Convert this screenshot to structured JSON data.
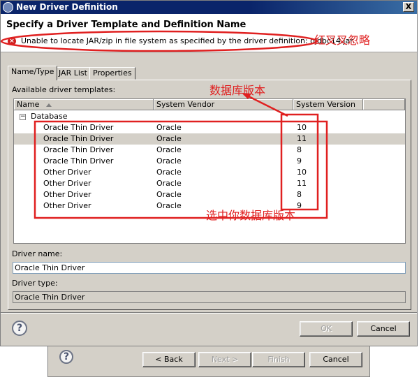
{
  "window": {
    "title": "New Driver Definition",
    "close_glyph": "X"
  },
  "header": {
    "title": "Specify a Driver Template and Definition Name",
    "error_icon": "error-icon",
    "error_message": "Unable to locate JAR/zip in file system as specified by the driver definition: ojdbc14.jar."
  },
  "tabs": [
    {
      "label": "Name/Type",
      "active": true
    },
    {
      "label": "JAR List",
      "active": false
    },
    {
      "label": "Properties",
      "active": false
    }
  ],
  "templates": {
    "label": "Available driver templates:",
    "columns": [
      "Name",
      "System Vendor",
      "System Version"
    ],
    "tree_toggle": "⊟",
    "group": "Database",
    "rows": [
      {
        "name": "Oracle Thin Driver",
        "vendor": "Oracle",
        "version": "10"
      },
      {
        "name": "Oracle Thin Driver",
        "vendor": "Oracle",
        "version": "11"
      },
      {
        "name": "Oracle Thin Driver",
        "vendor": "Oracle",
        "version": "8"
      },
      {
        "name": "Oracle Thin Driver",
        "vendor": "Oracle",
        "version": "9"
      },
      {
        "name": "Other Driver",
        "vendor": "Oracle",
        "version": "10"
      },
      {
        "name": "Other Driver",
        "vendor": "Oracle",
        "version": "11"
      },
      {
        "name": "Other Driver",
        "vendor": "Oracle",
        "version": "8"
      },
      {
        "name": "Other Driver",
        "vendor": "Oracle",
        "version": "9"
      }
    ]
  },
  "driver_name": {
    "label": "Driver name:",
    "value": "Oracle Thin Driver"
  },
  "driver_type": {
    "label": "Driver type:",
    "value": "Oracle Thin Driver"
  },
  "buttons": {
    "help": "?",
    "ok": "OK",
    "cancel": "Cancel"
  },
  "background_dialog": {
    "help": "?",
    "back": "< Back",
    "next": "Next >",
    "finish": "Finish",
    "cancel": "Cancel"
  },
  "annotations": {
    "ignore_error": "红叉叉忽略",
    "db_version": "数据库版本",
    "select_version": "选中你数据库版本"
  },
  "colors": {
    "annotation": "#e02020",
    "titlebar": "#0a246a",
    "face": "#d4d0c8"
  }
}
